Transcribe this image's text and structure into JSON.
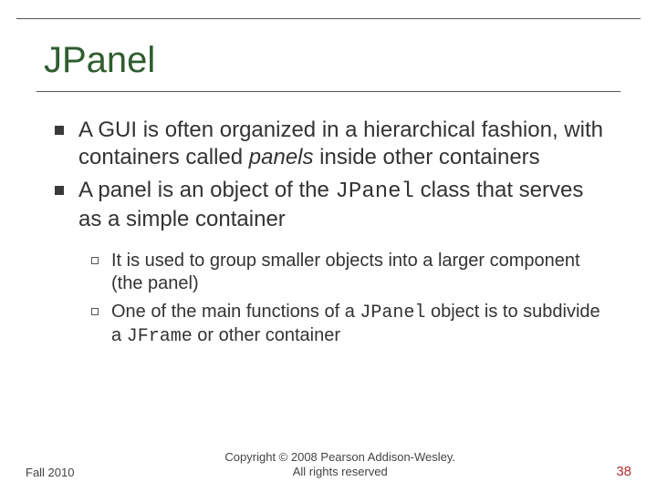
{
  "slide": {
    "title": "JPanel",
    "bullets": [
      {
        "pre": "A GUI is often organized in a hierarchical fashion, with containers called ",
        "em": "panels",
        "post": " inside other containers"
      },
      {
        "pre": "A panel is an object of the ",
        "code": "JPanel",
        "mid": " class that serves as a simple container"
      }
    ],
    "subbullets": [
      {
        "text": "It is used to group smaller objects into a larger component (the panel)"
      },
      {
        "pre": "One of the main functions of a ",
        "code1": "JPanel",
        "mid": " object is to subdivide a ",
        "code2": "JFrame",
        "post": " or other container"
      }
    ]
  },
  "footer": {
    "left": "Fall 2010",
    "center_l1": "Copyright © 2008 Pearson Addison-Wesley.",
    "center_l2": "All rights reserved",
    "page": "38"
  }
}
